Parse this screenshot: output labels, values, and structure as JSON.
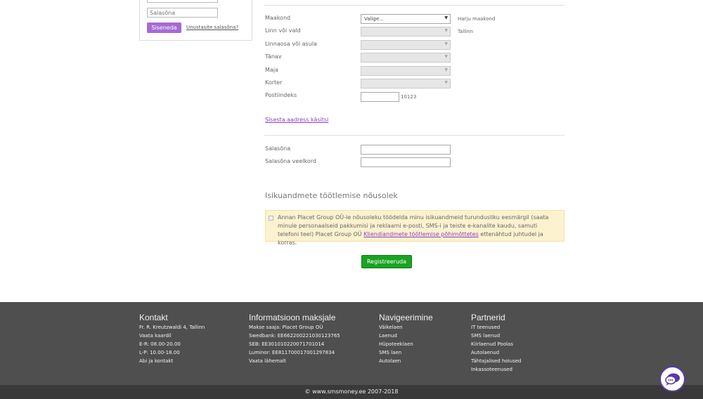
{
  "login": {
    "password_placeholder": "Salasõna",
    "submit_label": "Sisenedа",
    "forgot_label": "Unustasite salasõna?"
  },
  "address": {
    "county_label": "Maakond",
    "county_value": "Valige...",
    "county_hint": "Harju maakond",
    "city_label": "Linn või vald",
    "city_hint": "Tallinn",
    "district_label": "Linnaosa või asula",
    "street_label": "Tänav",
    "house_label": "Maja",
    "apartment_label": "Korter",
    "postal_label": "Postiindeks",
    "postal_hint": "10123",
    "manual_link": "Sisesta aadress käsitsi"
  },
  "password": {
    "password_label": "Salasõna",
    "repeat_label": "Salasõna veelkord"
  },
  "consent": {
    "title": "Isikuandmete töötlemise nõusolek",
    "text_before": "Annan Placet Group OÜ-le nõusoleku töödelda minu isikuandmeid turundusliku eesmärgil (saata minule personaalseid pakkumisi ja reklaami e-posti, SMS-i ja teiste e-kanalite kaudu, samuti telefoni teel) Placet Group OÜ ",
    "link_text": "Kliendiandmete töötlemise põhimõttetes",
    "text_after": " ettenähtud juhtudel ja korras."
  },
  "register_label": "Registreeruda",
  "footer": {
    "contact": {
      "title": "Kontakt",
      "lines": [
        "Fr. R. Kreutzwaldi 4, Tallinn",
        "Vaata kaardil",
        "E-R: 08.00-20.00",
        "L-P: 10.00-18.00",
        "Abi ja kontakt"
      ]
    },
    "payment": {
      "title": "Informatsioon maksjale",
      "lines": [
        "Makse saaja: Placet Group OÜ",
        "Swedbank: EE662200221030123765",
        "SEB: EE301010220071701014",
        "Luminor: EE811700017001297834",
        "Vaata lähemalt"
      ]
    },
    "navigation": {
      "title": "Navigeerimine",
      "lines": [
        "Väikelaen",
        "Laenud",
        "Hüpoteeklaen",
        "SMS laen",
        "Autolaen"
      ]
    },
    "partners": {
      "title": "Partnerid",
      "lines": [
        "IT teenused",
        "SMS laenud",
        "Kiirlaenud Poolas",
        "Autolaenud",
        "Tähtajalised hoiused",
        "Inkassoteenused"
      ]
    },
    "copyright": "© www.smsmoney.ee 2007-2018"
  },
  "colors": {
    "accent_purple": "#a56ad3",
    "register_green": "#1aa322",
    "footer_bg": "#4f4f4f",
    "consent_bg": "#fcf2cf"
  }
}
